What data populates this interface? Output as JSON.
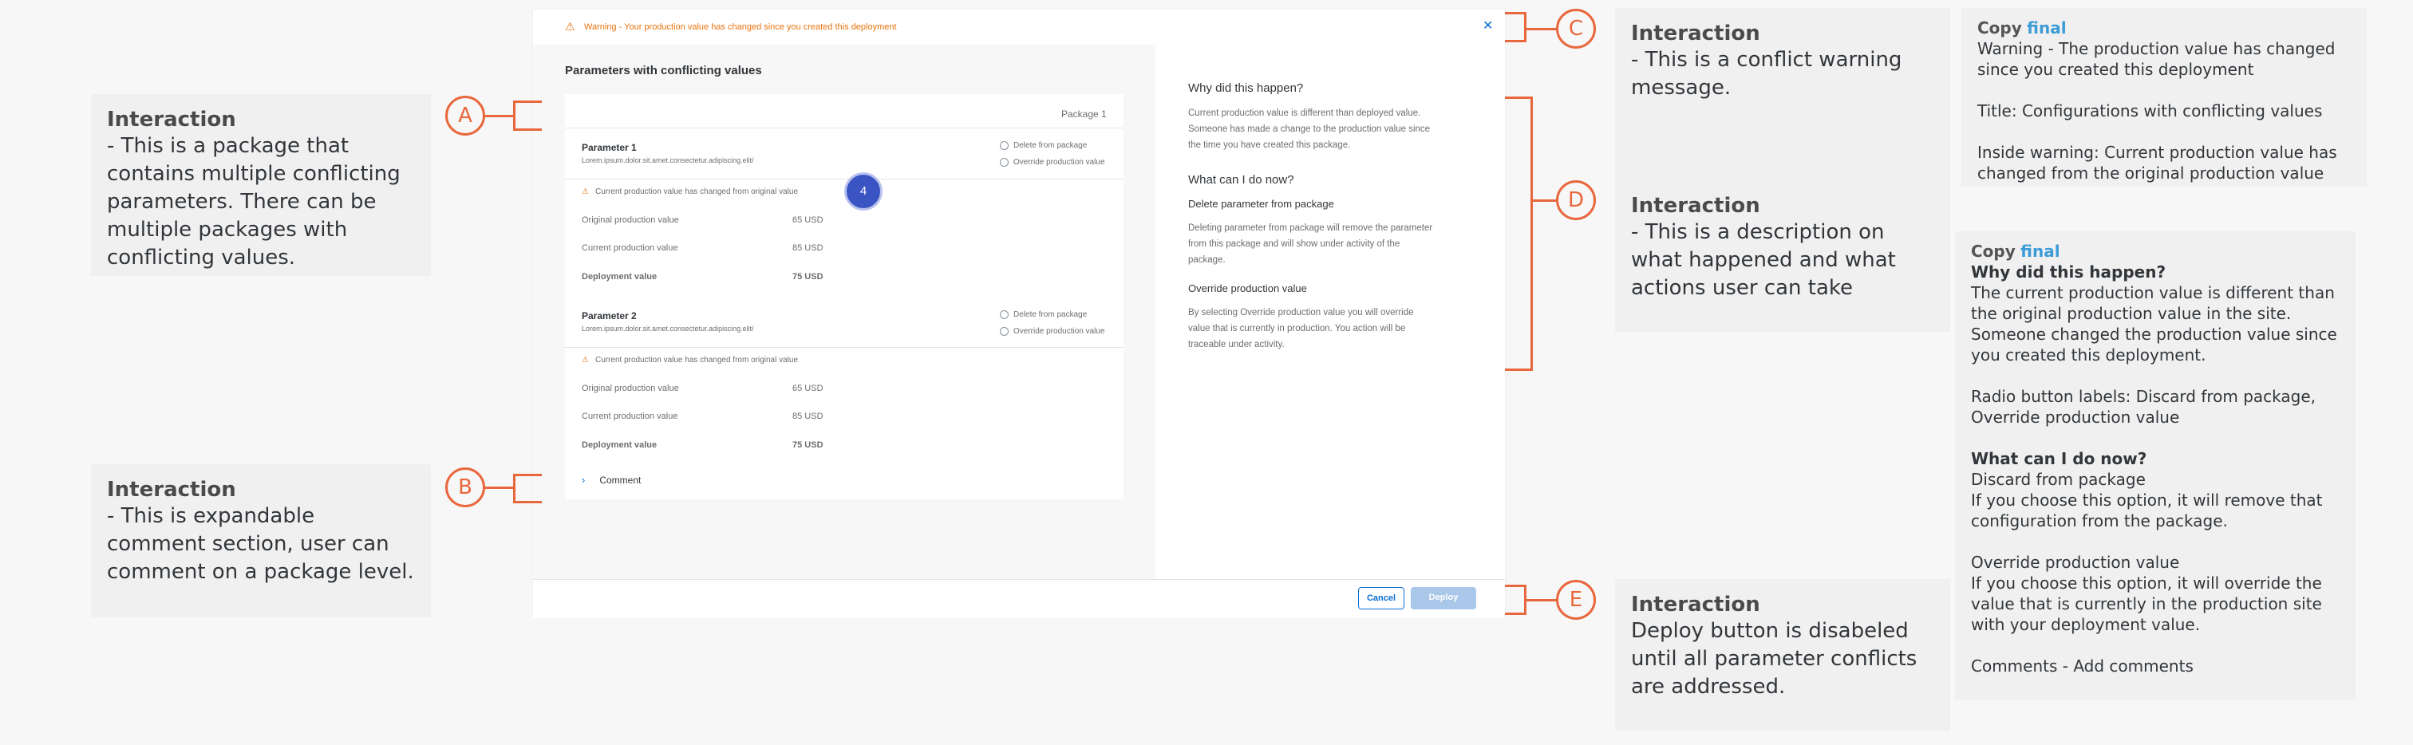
{
  "dialog": {
    "warning_text": "Warning - Your production value has changed since you created this deployment",
    "title": "Parameters with conflicting values",
    "package_label": "Package 1",
    "step_badge": "4",
    "comment_label": "Comment",
    "cancel_label": "Cancel",
    "deploy_label": "Deploy",
    "parameters": [
      {
        "name": "Parameter 1",
        "description": "Lorem.ipsum.dolor.sit.amet.consectetur.adipiscing.elit/",
        "option_delete": "Delete from package",
        "option_override": "Override production value",
        "inline_warning": "Current production value has changed from original value",
        "rows": [
          {
            "label": "Original production value",
            "value": "65 USD"
          },
          {
            "label": "Current production value",
            "value": "85 USD"
          },
          {
            "label": "Deployment value",
            "value": "75 USD"
          }
        ]
      },
      {
        "name": "Parameter 2",
        "description": "Lorem.ipsum.dolor.sit.amet.consectetur.adipiscing.elit/",
        "option_delete": "Delete from package",
        "option_override": "Override production value",
        "inline_warning": "Current production value has changed from original value",
        "rows": [
          {
            "label": "Original production value",
            "value": "65 USD"
          },
          {
            "label": "Current production value",
            "value": "85 USD"
          },
          {
            "label": "Deployment value",
            "value": "75 USD"
          }
        ]
      }
    ],
    "help": {
      "why_title": "Why did this happen?",
      "why_text": "Current production value is different than deployed value. Someone has made a change to the production value since the time you have created this package.",
      "what_title": "What can I do now?",
      "delete_title": "Delete parameter from package",
      "delete_text": "Deleting parameter from package will remove the parameter from this package and will show under activity of the package.",
      "override_title": "Override production value",
      "override_text": "By selecting Override production value you will override value that is currently in production. You action will be traceable under activity."
    }
  },
  "markers": {
    "a": "A",
    "b": "B",
    "c": "C",
    "d": "D",
    "e": "E"
  },
  "notes": {
    "a": {
      "title": "Interaction",
      "text": "- This is a package that contains multiple conflicting parameters. There can be multiple packages with conflicting values."
    },
    "b": {
      "title": "Interaction",
      "text": "- This is expandable comment section, user can comment on a package level."
    },
    "c": {
      "title": "Interaction",
      "text": "- This is a conflict warning message."
    },
    "d": {
      "title": "Interaction",
      "text": "- This is a description on what happened and what actions user can take"
    },
    "e": {
      "title": "Interaction",
      "text": "Deploy button is disabeled until all parameter conflicts are addressed."
    }
  },
  "copy1": {
    "head": "Copy",
    "final": "final",
    "line1": "Warning - The production value has changed since you created this deployment",
    "line2": "Title: Configurations with conflicting values",
    "line3": "Inside warning: Current production value has changed from the original production value"
  },
  "copy2": {
    "head": "Copy",
    "final": "final",
    "why_title": "Why did this happen?",
    "why_text": "The current production value is different than the original production value in the site. Someone changed the production value since you created this deployment.",
    "radio_labels": "Radio button labels: Discard from package, Override production value",
    "what_title": "What can I do now?",
    "discard_title": "Discard from package",
    "discard_text": "If you choose this option, it will remove that configuration from the package.",
    "override_title": "Override production value",
    "override_text": "If you choose this option, it will override the value that is currently in the production site with your deployment value.",
    "comments": "Comments - Add comments"
  },
  "colors": {
    "accent": "#e8673c",
    "warning": "#e9730c",
    "badge": "#3b54c4",
    "link": "#0a6ed1"
  }
}
